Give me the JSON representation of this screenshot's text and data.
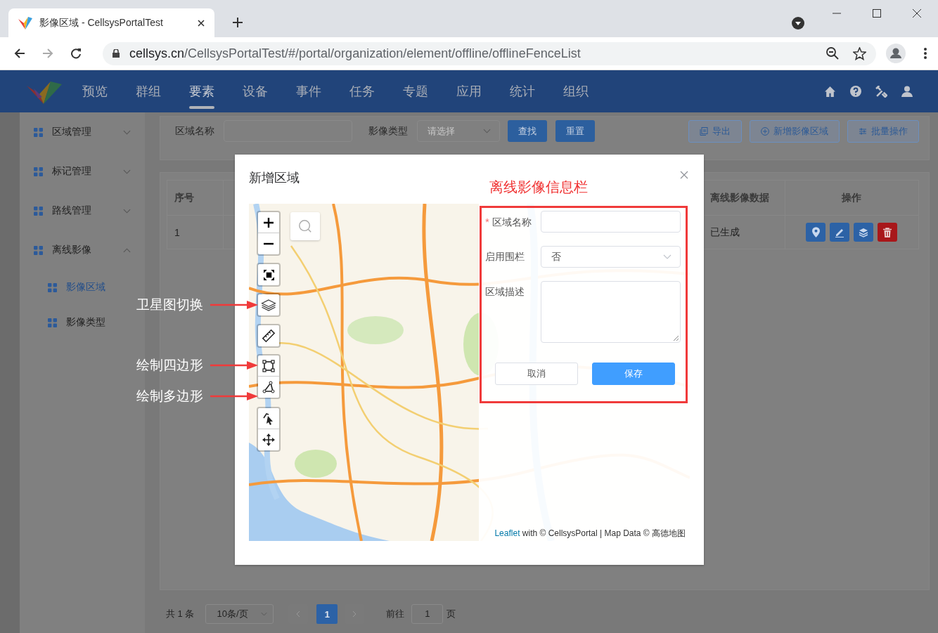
{
  "browser": {
    "tab_title": "影像区域 - CellsysPortalTest",
    "url_host": "cellsys.cn",
    "url_path": "/CellsysPortalTest/#/portal/organization/element/offline/offlineFenceList"
  },
  "nav": {
    "items": [
      {
        "label": "预览",
        "selected": false
      },
      {
        "label": "群组",
        "selected": false
      },
      {
        "label": "要素",
        "selected": true
      },
      {
        "label": "设备",
        "selected": false
      },
      {
        "label": "事件",
        "selected": false
      },
      {
        "label": "任务",
        "selected": false
      },
      {
        "label": "专题",
        "selected": false
      },
      {
        "label": "应用",
        "selected": false
      },
      {
        "label": "统计",
        "selected": false
      },
      {
        "label": "组织",
        "selected": false
      }
    ]
  },
  "sidebar": {
    "items": [
      {
        "label": "区域管理",
        "expanded": false
      },
      {
        "label": "标记管理",
        "expanded": false
      },
      {
        "label": "路线管理",
        "expanded": false
      },
      {
        "label": "离线影像",
        "expanded": true,
        "children": [
          {
            "label": "影像区域",
            "selected": true
          },
          {
            "label": "影像类型",
            "selected": false
          }
        ]
      }
    ]
  },
  "filter": {
    "fields": [
      {
        "label": "区域名称",
        "kind": "input"
      },
      {
        "label": "影像类型",
        "kind": "select",
        "placeholder": "请选择"
      }
    ],
    "buttons": [
      {
        "label": "查找"
      },
      {
        "label": "重置"
      }
    ],
    "actions": [
      {
        "label": "导出",
        "kind": "export"
      },
      {
        "label": "新增影像区域",
        "kind": "add"
      },
      {
        "label": "批量操作",
        "kind": "batch"
      }
    ]
  },
  "table": {
    "columns": [
      "序号",
      "离线影像数据",
      "操作"
    ],
    "rows": [
      {
        "cells": [
          "1",
          "已生成"
        ],
        "actions": [
          {
            "kind": "locate"
          },
          {
            "kind": "edit"
          },
          {
            "kind": "layers"
          },
          {
            "kind": "delete"
          }
        ]
      }
    ]
  },
  "pagination": {
    "total": "共 1 条",
    "page_size": "10条/页",
    "pages": [
      {
        "label": "1",
        "selected": true
      }
    ],
    "goto_label": "前往",
    "goto_value": "1",
    "goto_suffix": "页"
  },
  "dialog": {
    "title": "新增区域",
    "annotation": "离线影像信息栏",
    "map": {
      "kind": "picture",
      "attribution_link": "Leaflet",
      "attribution": "with © CellsysPortal | Map Data © 高德地图"
    },
    "form": {
      "fields": [
        {
          "label": "区域名称",
          "kind": "input",
          "required_mark": "*"
        },
        {
          "label": "启用围栏",
          "kind": "select",
          "value": "否"
        },
        {
          "label": "区域描述",
          "kind": "textarea"
        }
      ],
      "buttons": [
        {
          "label": "取消",
          "primary": false
        },
        {
          "label": "保存",
          "primary": true
        }
      ]
    }
  },
  "callouts": [
    "卫星图切换",
    "绘制四边形",
    "绘制多边形"
  ]
}
